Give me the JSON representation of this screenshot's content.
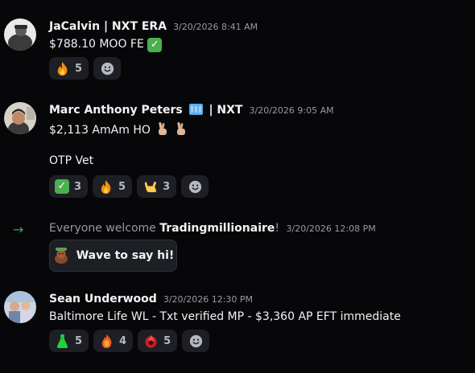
{
  "messages": [
    {
      "author": "JaCalvin | NXT ERA",
      "timestamp": "3/20/2026 8:41 AM",
      "lines": [
        "$788.10 MOO FE"
      ],
      "reactions": [
        {
          "emoji": "fire",
          "count": "5"
        }
      ]
    },
    {
      "author": "Marc Anthony Peters",
      "author_suffix": "| NXT",
      "timestamp": "3/20/2026 9:05 AM",
      "lines": [
        "$2,113 AmAm HO",
        "OTP Vet"
      ],
      "reactions": [
        {
          "emoji": "check-mark",
          "count": "3"
        },
        {
          "emoji": "fire",
          "count": "5"
        },
        {
          "emoji": "call-me-hand",
          "count": "3"
        }
      ]
    },
    {
      "author": "Sean Underwood",
      "timestamp": "3/20/2026 12:30 PM",
      "lines": [
        "Baltimore Life WL - Txt verified MP - $3,360 AP EFT immediate"
      ],
      "reactions": [
        {
          "emoji": "green-flask",
          "count": "5"
        },
        {
          "emoji": "fire-hand",
          "count": "4"
        },
        {
          "emoji": "red-fire-orb",
          "count": "5"
        }
      ]
    }
  ],
  "system": {
    "prefix": "Everyone welcome ",
    "username": "Tradingmillionaire",
    "suffix": "!",
    "timestamp": "3/20/2026 12:08 PM",
    "wave_button": "Wave to say hi!"
  },
  "colors": {
    "background": "#070709",
    "reaction_bg": "#1d1f24",
    "join_arrow": "#3ba55c",
    "check_green": "#4caf50"
  }
}
